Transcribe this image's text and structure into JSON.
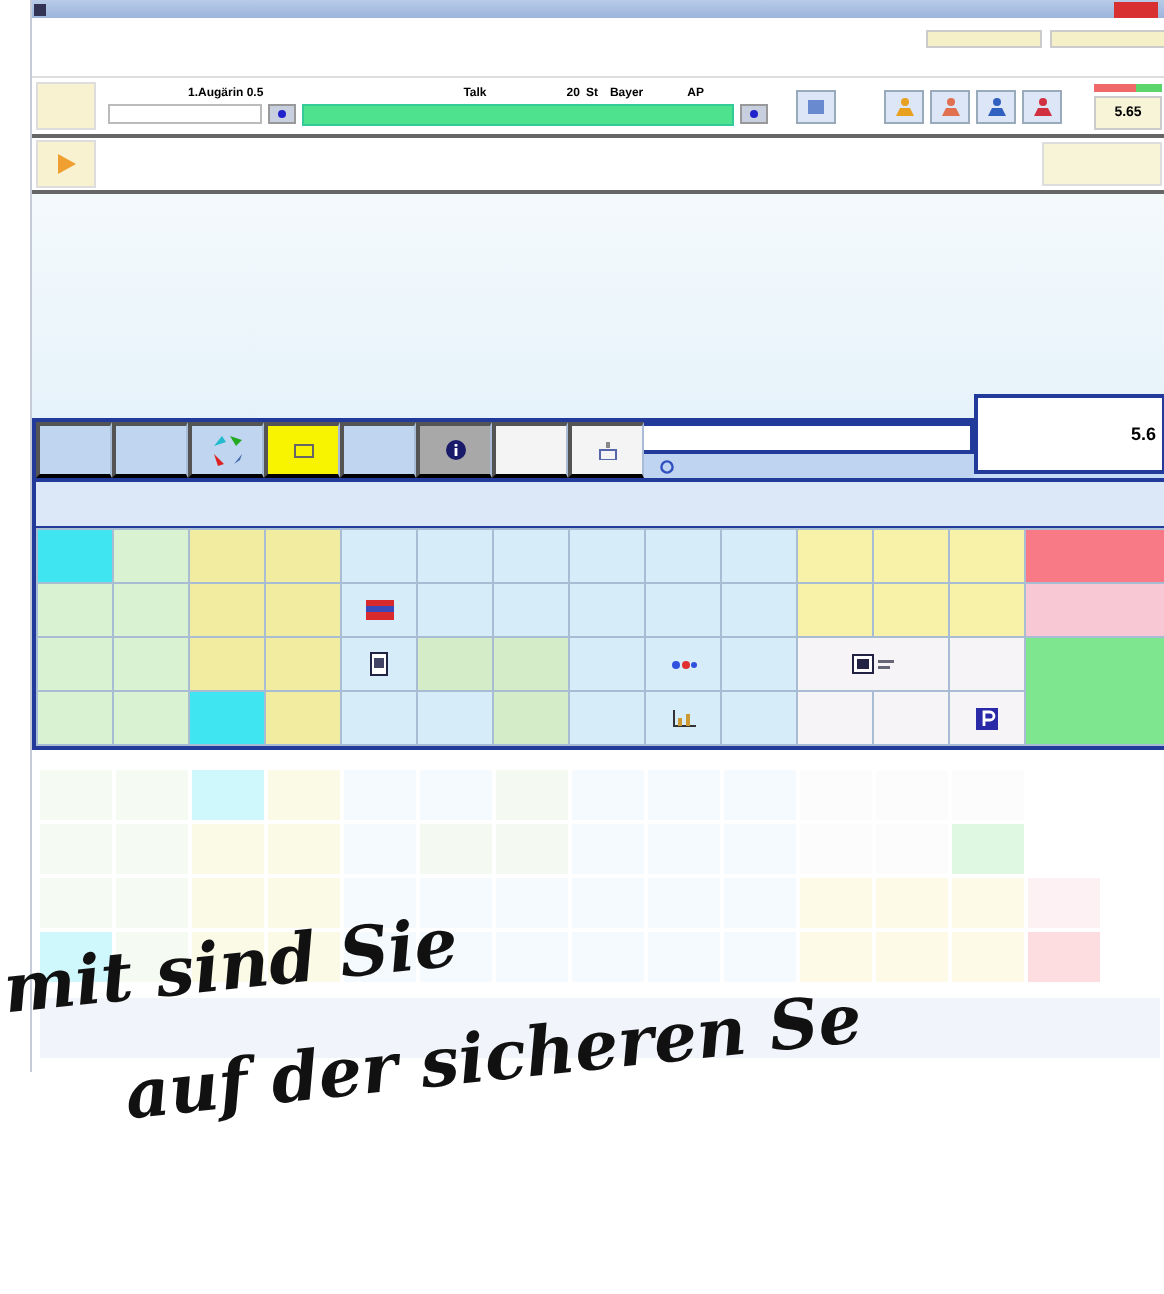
{
  "header": {
    "item": "1.Augärin 0.5",
    "unit": "Talk",
    "quantity": "20",
    "quantity_unit": "St",
    "supplier": "Bayer",
    "code": "AP",
    "total": "5.65",
    "meter": {
      "level": 0.62
    }
  },
  "toolbar": {
    "amount": "5.6"
  },
  "grid": [
    [
      {
        "color": "#3fe6f2",
        "kind": "blank"
      },
      {
        "color": "#d8f2d2",
        "kind": "blank"
      },
      {
        "color": "#f2eca0",
        "kind": "blank"
      },
      {
        "color": "#f2eca0",
        "kind": "blank"
      },
      {
        "color": "#d6ecf8",
        "kind": "blank"
      },
      {
        "color": "#d6ecf8",
        "kind": "blank"
      },
      {
        "color": "#d6ecf8",
        "kind": "blank"
      },
      {
        "color": "#d6ecf8",
        "kind": "blank"
      },
      {
        "color": "#d6ecf8",
        "kind": "blank"
      },
      {
        "color": "#d6ecf8",
        "kind": "blank"
      },
      {
        "color": "#f8f2a8",
        "kind": "blank"
      },
      {
        "color": "#f8f2a8",
        "kind": "blank"
      },
      {
        "color": "#f8f2a8",
        "kind": "blank"
      },
      {
        "color": "#f87a86",
        "kind": "blank"
      }
    ],
    [
      {
        "color": "#d8f2d2",
        "kind": "blank"
      },
      {
        "color": "#d8f2d2",
        "kind": "blank"
      },
      {
        "color": "#f2eca0",
        "kind": "blank"
      },
      {
        "color": "#f2eca0",
        "kind": "blank"
      },
      {
        "color": "#d6ecf8",
        "kind": "card"
      },
      {
        "color": "#d6ecf8",
        "kind": "blank"
      },
      {
        "color": "#d6ecf8",
        "kind": "blank"
      },
      {
        "color": "#d6ecf8",
        "kind": "blank"
      },
      {
        "color": "#d6ecf8",
        "kind": "blank"
      },
      {
        "color": "#d6ecf8",
        "kind": "blank"
      },
      {
        "color": "#f8f2a8",
        "kind": "blank"
      },
      {
        "color": "#f8f2a8",
        "kind": "blank"
      },
      {
        "color": "#f8f2a8",
        "kind": "blank"
      },
      {
        "color": "#f8c8d4",
        "kind": "blank"
      }
    ],
    [
      {
        "color": "#d8f2d2",
        "kind": "blank"
      },
      {
        "color": "#d8f2d2",
        "kind": "blank"
      },
      {
        "color": "#f2eca0",
        "kind": "blank"
      },
      {
        "color": "#f2eca0",
        "kind": "blank"
      },
      {
        "color": "#d6ecf8",
        "kind": "document"
      },
      {
        "color": "#d4ecc8",
        "kind": "blank"
      },
      {
        "color": "#d4ecc8",
        "kind": "blank"
      },
      {
        "color": "#d6ecf8",
        "kind": "blank"
      },
      {
        "color": "#d6ecf8",
        "kind": "dots"
      },
      {
        "color": "#d6ecf8",
        "kind": "blank"
      },
      {
        "color": "#f6f4f6",
        "kind": "display",
        "wide": true
      },
      {
        "color": "#f6f4f6",
        "kind": "blank"
      },
      {
        "color": "#7ee68e",
        "kind": "blank",
        "tall": true
      }
    ],
    [
      {
        "color": "#d8f2d2",
        "kind": "blank"
      },
      {
        "color": "#d8f2d2",
        "kind": "blank"
      },
      {
        "color": "#3fe6f2",
        "kind": "blank"
      },
      {
        "color": "#f2eca0",
        "kind": "blank"
      },
      {
        "color": "#d6ecf8",
        "kind": "blank"
      },
      {
        "color": "#d6ecf8",
        "kind": "blank"
      },
      {
        "color": "#d4ecc8",
        "kind": "blank"
      },
      {
        "color": "#d6ecf8",
        "kind": "blank"
      },
      {
        "color": "#d6ecf8",
        "kind": "chart"
      },
      {
        "color": "#d6ecf8",
        "kind": "blank"
      },
      {
        "color": "#f6f4f6",
        "kind": "blank"
      },
      {
        "color": "#f6f4f6",
        "kind": "blank"
      },
      {
        "color": "#f6f4f6",
        "kind": "parking"
      }
    ]
  ],
  "slogan": [
    "mit sind Sie",
    "auf der sicheren Se"
  ]
}
